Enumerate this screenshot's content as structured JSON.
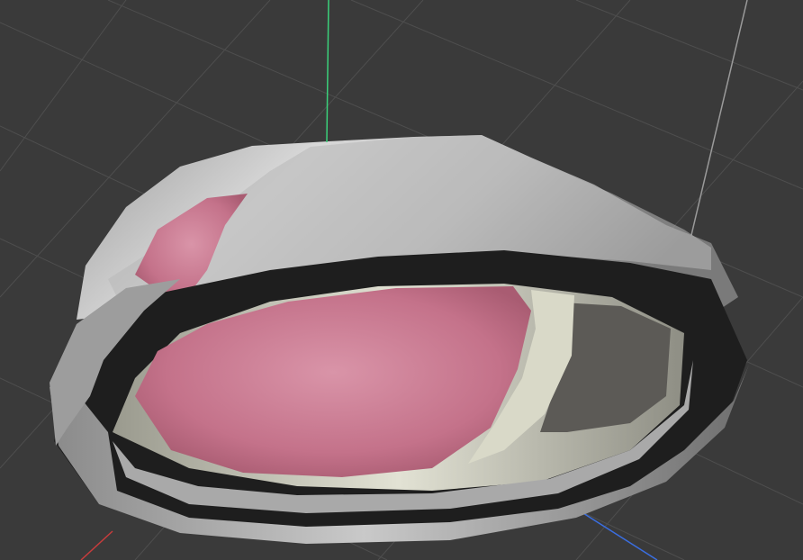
{
  "viewport": {
    "background": "#3a3a3a",
    "grid_color": "#4e4e4e",
    "grid_visible": true,
    "axes": {
      "x_color": "#c83c3c",
      "y_color": "#3ad07a",
      "z_color": "#3a6ee0"
    }
  },
  "model": {
    "outer_light": "#d6d6d6",
    "outer_mid": "#a8a8a8",
    "outer_shadow": "#6a6a6a",
    "rim_dark": "#1e1e1e",
    "inner_fill": "#c8748c",
    "inner_light": "#dba6b6",
    "inner_ring": "#c9c9b4"
  }
}
